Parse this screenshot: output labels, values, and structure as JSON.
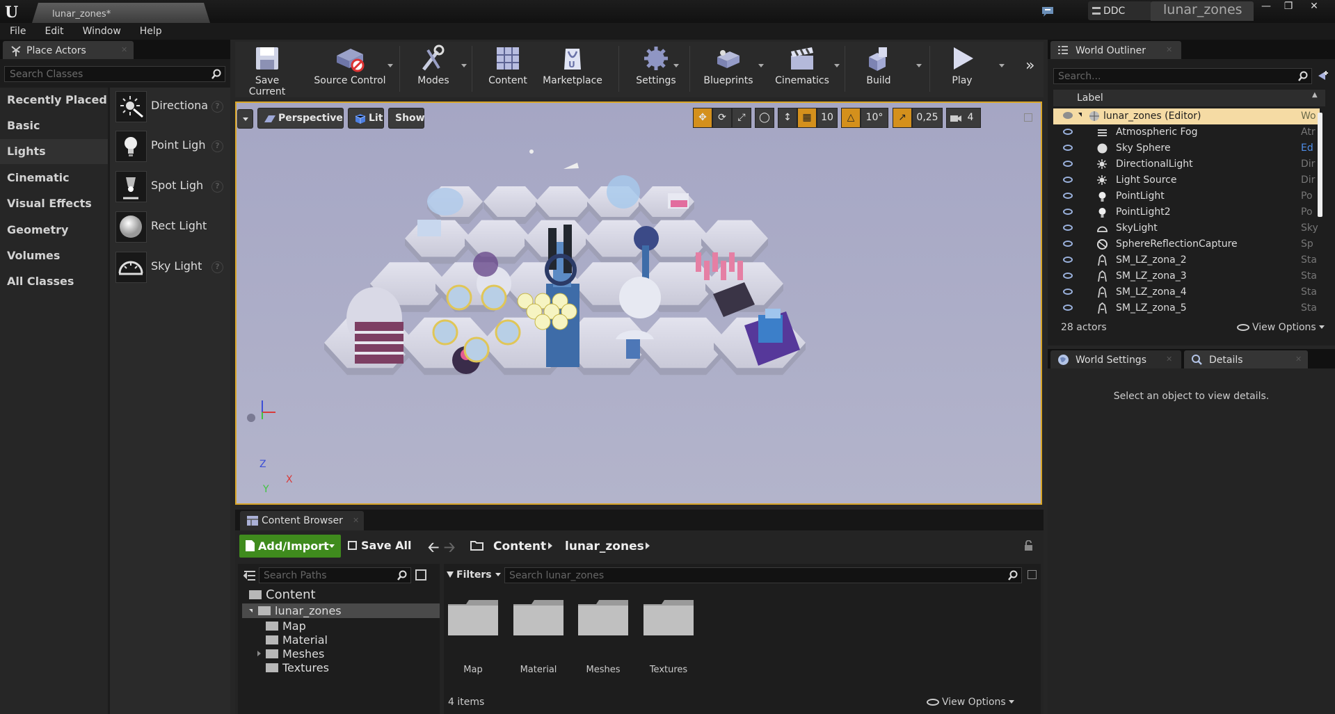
{
  "title_bar": {
    "tab_label": "lunar_zones*",
    "ddc": "DDC",
    "project_name": "lunar_zones"
  },
  "menu": [
    "File",
    "Edit",
    "Window",
    "Help"
  ],
  "place_actors": {
    "tab": "Place Actors",
    "search_placeholder": "Search Classes",
    "categories": [
      "Recently Placed",
      "Basic",
      "Lights",
      "Cinematic",
      "Visual Effects",
      "Geometry",
      "Volumes",
      "All Classes"
    ],
    "selected_category": "Lights",
    "actors": [
      "Directiona",
      "Point Ligh",
      "Spot Ligh",
      "Rect Light",
      "Sky Light"
    ]
  },
  "toolbar": {
    "save_current": "Save Current",
    "source_control": "Source Control",
    "modes": "Modes",
    "content": "Content",
    "marketplace": "Marketplace",
    "settings": "Settings",
    "blueprints": "Blueprints",
    "cinematics": "Cinematics",
    "build": "Build",
    "play": "Play"
  },
  "viewport": {
    "perspective": "Perspective",
    "lit": "Lit",
    "show": "Show",
    "grid_snap": "10",
    "rotation_snap": "10°",
    "scale_snap": "0,25",
    "camera_speed": "4",
    "axis_z": "Z",
    "axis_x": "X",
    "axis_y": "Y"
  },
  "content_browser": {
    "tab": "Content Browser",
    "add_import": "Add/Import",
    "save_all": "Save All",
    "breadcrumb": [
      "Content",
      "lunar_zones"
    ],
    "search_paths_placeholder": "Search Paths",
    "filters": "Filters",
    "search_assets_placeholder": "Search lunar_zones",
    "tree": {
      "root": "Content",
      "project": "lunar_zones",
      "children": [
        "Map",
        "Material",
        "Meshes",
        "Textures"
      ]
    },
    "assets": [
      "Map",
      "Material",
      "Meshes",
      "Textures"
    ],
    "item_count": "4 items",
    "view_options": "View Options"
  },
  "world_outliner": {
    "tab": "World Outliner",
    "search_placeholder": "Search...",
    "column_label": "Label",
    "rows": [
      {
        "label": "lunar_zones (Editor)",
        "type": "Wo"
      },
      {
        "label": "Atmospheric Fog",
        "type": "Atr"
      },
      {
        "label": "Sky Sphere",
        "type": "Ed"
      },
      {
        "label": "DirectionalLight",
        "type": "Dir"
      },
      {
        "label": "Light Source",
        "type": "Dir"
      },
      {
        "label": "PointLight",
        "type": "Po"
      },
      {
        "label": "PointLight2",
        "type": "Po"
      },
      {
        "label": "SkyLight",
        "type": "Sky"
      },
      {
        "label": "SphereReflectionCapture",
        "type": "Sp"
      },
      {
        "label": "SM_LZ_zona_2",
        "type": "Sta"
      },
      {
        "label": "SM_LZ_zona_3",
        "type": "Sta"
      },
      {
        "label": "SM_LZ_zona_4",
        "type": "Sta"
      },
      {
        "label": "SM_LZ_zona_5",
        "type": "Sta"
      }
    ],
    "actor_count": "28 actors",
    "view_options": "View Options"
  },
  "details": {
    "world_settings_tab": "World Settings",
    "details_tab": "Details",
    "empty_message": "Select an object to view details."
  },
  "colors": {
    "selection_accent": "#d9a628",
    "add_import_green": "#3f8b1d",
    "selected_row": "#f5dba4"
  }
}
